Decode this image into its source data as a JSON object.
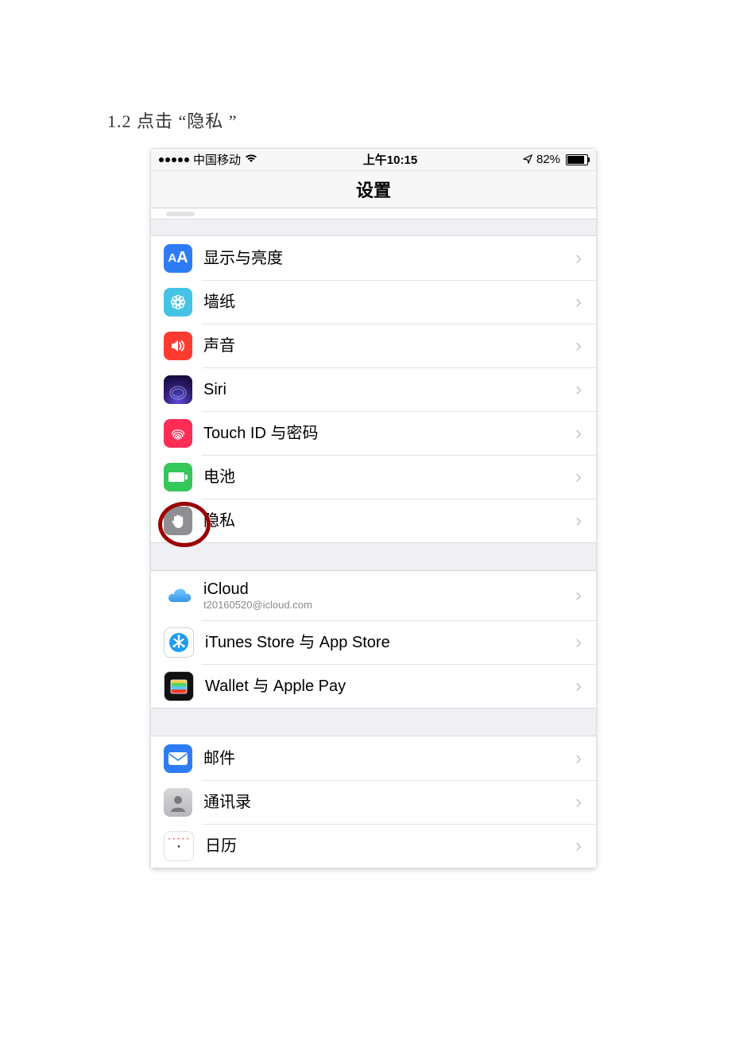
{
  "caption": "1.2  点击 “隐私 ”",
  "status": {
    "carrier": "中国移动",
    "time": "上午10:15",
    "battery": "82%"
  },
  "title": "设置",
  "group1": [
    {
      "label": "显示与亮度"
    },
    {
      "label": "墙纸"
    },
    {
      "label": "声音"
    },
    {
      "label": "Siri"
    },
    {
      "label": "Touch ID 与密码"
    },
    {
      "label": "电池"
    },
    {
      "label": "隐私"
    }
  ],
  "group2": [
    {
      "label": "iCloud",
      "sub": "t20160520@icloud.com"
    },
    {
      "label": "iTunes Store 与 App Store"
    },
    {
      "label": "Wallet 与 Apple Pay"
    }
  ],
  "group3": [
    {
      "label": "邮件"
    },
    {
      "label": "通讯录"
    },
    {
      "label": "日历"
    }
  ]
}
